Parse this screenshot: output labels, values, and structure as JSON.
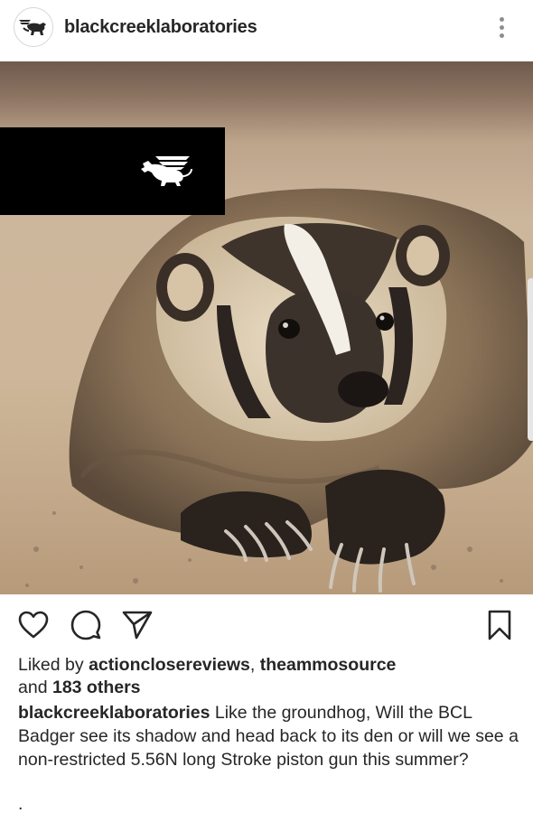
{
  "post": {
    "username": "blackcreeklaboratories",
    "avatar_icon": "griffin-logo-icon",
    "more_icon": "more-vertical-icon",
    "image_subject": "badger",
    "actions": {
      "like_icon": "heart-icon",
      "comment_icon": "comment-icon",
      "share_icon": "send-icon",
      "save_icon": "bookmark-icon"
    },
    "likes": {
      "prefix": "Liked by",
      "user1": "actionclosereviews",
      "separator": ",",
      "user2": "theammosource",
      "and": "and",
      "others": "183 others"
    },
    "caption": {
      "username": "blackcreeklaboratories",
      "text": "Like the groundhog, Will the BCL Badger see its shadow and head back to its den or will we see a non-restricted 5.56N long Stroke piston gun this summer?"
    },
    "trailing": "."
  },
  "colors": {
    "text": "#262626",
    "icon": "#262626",
    "logo_bg": "#000000",
    "logo_fg": "#ffffff"
  }
}
